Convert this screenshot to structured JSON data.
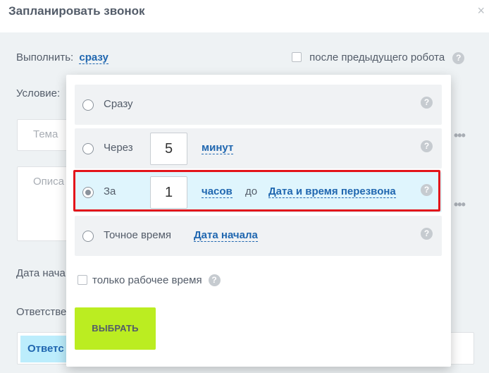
{
  "dialog": {
    "title": "Запланировать звонок",
    "close": "×"
  },
  "form": {
    "execute_label": "Выполнить:",
    "execute_value": "сразу",
    "after_previous_label": "после предыдущего робота",
    "condition_label": "Условие:",
    "topic_placeholder": "Тема",
    "description_placeholder": "Описа",
    "start_date_label": "Дата нача",
    "responsible_label": "Ответстве",
    "responsible_value": "Ответс",
    "more_dots": "•••"
  },
  "popup": {
    "options": [
      {
        "label": "Сразу",
        "selected": false
      },
      {
        "label": "Через",
        "value": "5",
        "unit": "минут",
        "selected": false
      },
      {
        "label": "За",
        "value": "1",
        "unit": "часов",
        "before_word": "до",
        "target": "Дата и время перезвона",
        "selected": true
      },
      {
        "label": "Точное время",
        "target": "Дата начала",
        "selected": false
      }
    ],
    "only_work_time": "только рабочее время",
    "select_button": "ВЫБРАТЬ",
    "help": "?"
  },
  "colors": {
    "accent": "#2067b0",
    "button": "#bbed21",
    "highlight": "#e3151b",
    "selected_row": "#dff5fd"
  }
}
